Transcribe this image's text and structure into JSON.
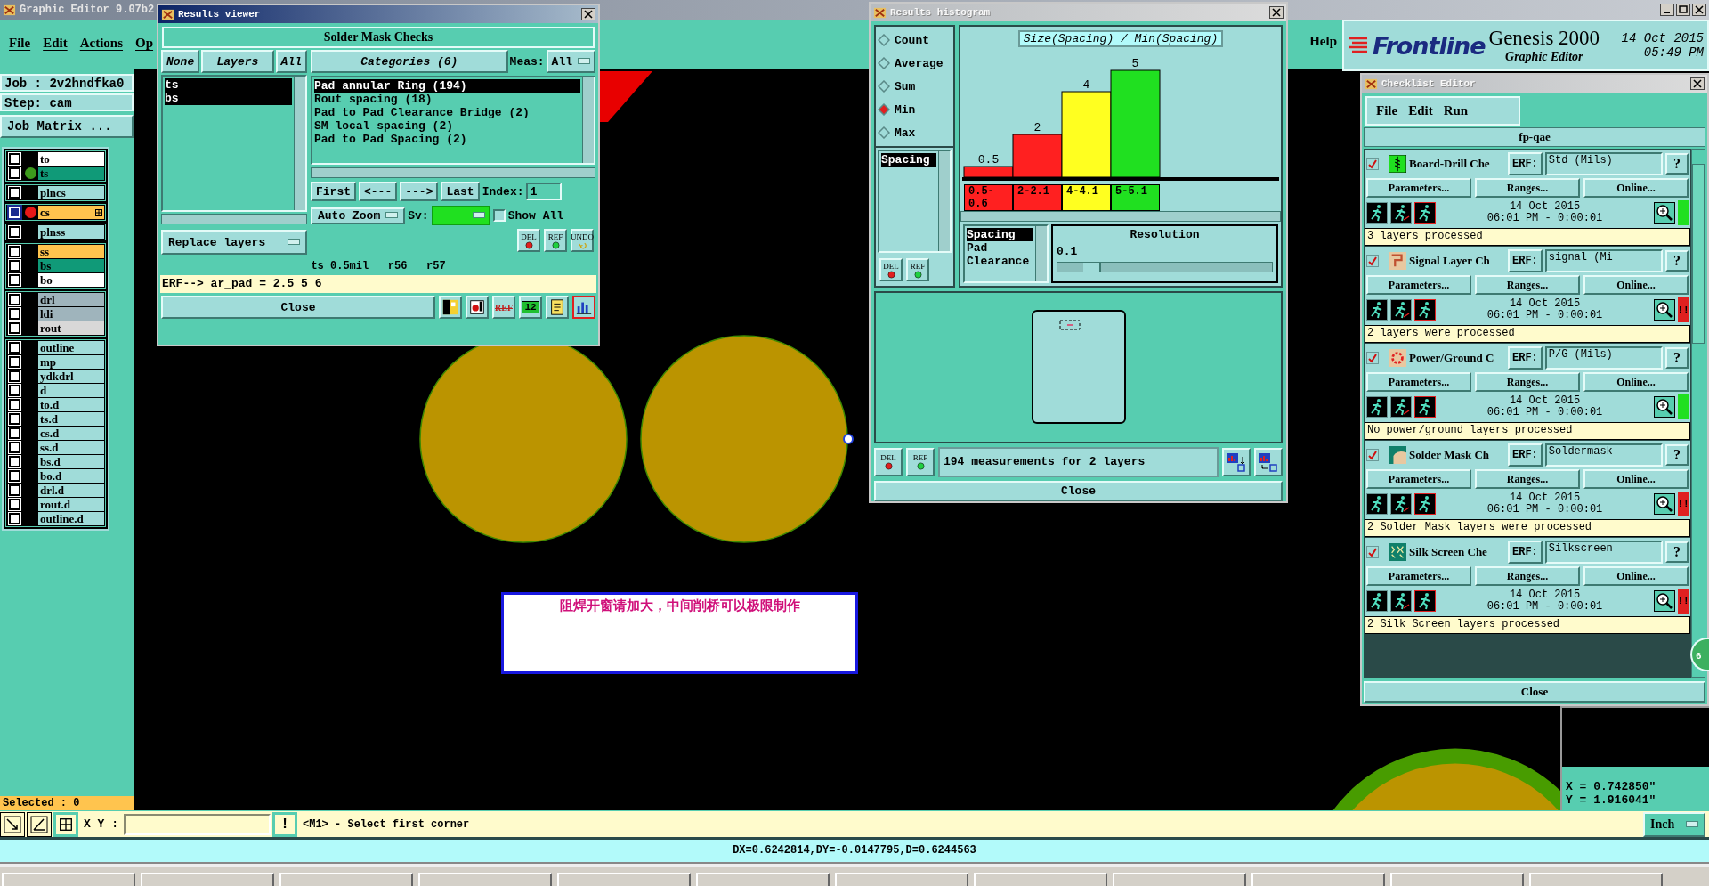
{
  "main_window": {
    "title": "Graphic Editor 9.07b2",
    "menu": [
      "File",
      "Edit",
      "Actions",
      "Op"
    ],
    "help": "Help"
  },
  "branding": {
    "logo": "Frontline",
    "product": "Genesis 2000",
    "subtitle": "Graphic Editor",
    "date": "14 Oct 2015",
    "time": "05:49 PM"
  },
  "job_panel": {
    "job": "Job : 2v2hndfka0",
    "step": "Step: cam",
    "job_matrix": "Job Matrix ...",
    "selected_count": "Selected : 0",
    "layer_groups": [
      [
        {
          "name": "to",
          "color": "#ffffff",
          "selected": false
        },
        {
          "name": "ts",
          "color": "#109a78",
          "selected": false,
          "dot": {
            "color": "#3c9a1c"
          }
        }
      ],
      [
        {
          "name": "plncs",
          "color": "#a0dcd9",
          "selected": false
        }
      ],
      [
        {
          "name": "cs",
          "color": "#ffc44e",
          "selected": true,
          "dot": {
            "color": "#e81818"
          }
        }
      ],
      [
        {
          "name": "plnss",
          "color": "#a0dcd9",
          "selected": false
        }
      ],
      [
        {
          "name": "ss",
          "color": "#ffc44e",
          "selected": false
        },
        {
          "name": "bs",
          "color": "#109a78",
          "selected": false
        },
        {
          "name": "bo",
          "color": "#ffffff",
          "selected": false
        }
      ],
      [
        {
          "name": "drl",
          "color": "#9fb4bc",
          "selected": false
        },
        {
          "name": "ldi",
          "color": "#9fb4bc",
          "selected": false
        },
        {
          "name": "rout",
          "color": "#d8d8d8",
          "selected": false
        }
      ],
      [
        {
          "name": "outline",
          "color": "#a0dcd9",
          "selected": false
        },
        {
          "name": "mp",
          "color": "#a0dcd9",
          "selected": false
        },
        {
          "name": "ydkdrl",
          "color": "#a0dcd9",
          "selected": false
        },
        {
          "name": "d",
          "color": "#a0dcd9",
          "selected": false
        },
        {
          "name": "to.d",
          "color": "#a0dcd9",
          "selected": false
        },
        {
          "name": "ts.d",
          "color": "#a0dcd9",
          "selected": false
        },
        {
          "name": "cs.d",
          "color": "#a0dcd9",
          "selected": false
        },
        {
          "name": "ss.d",
          "color": "#a0dcd9",
          "selected": false
        },
        {
          "name": "bs.d",
          "color": "#a0dcd9",
          "selected": false
        },
        {
          "name": "bo.d",
          "color": "#a0dcd9",
          "selected": false
        },
        {
          "name": "drl.d",
          "color": "#a0dcd9",
          "selected": false
        },
        {
          "name": "rout.d",
          "color": "#a0dcd9",
          "selected": false
        },
        {
          "name": "outline.d",
          "color": "#a0dcd9",
          "selected": false
        }
      ]
    ]
  },
  "results_viewer": {
    "title": "Results viewer",
    "heading": "Solder Mask Checks",
    "layer_buttons": [
      "None",
      "Layers",
      "All"
    ],
    "layers": [
      {
        "name": "ts",
        "selected": true
      },
      {
        "name": "bs",
        "selected": true
      }
    ],
    "replace": "Replace layers",
    "categories_button": "Categories (6)",
    "meas_label": "Meas:",
    "meas_value": "All",
    "categories": [
      {
        "label": "Pad annular Ring (194)",
        "selected": true
      },
      {
        "label": "Rout spacing (18)",
        "selected": false
      },
      {
        "label": "Pad to Pad Clearance Bridge (2)",
        "selected": false
      },
      {
        "label": "SM local spacing (2)",
        "selected": false
      },
      {
        "label": "Pad to Pad Spacing (2)",
        "selected": false
      }
    ],
    "nav": [
      "First",
      "<---",
      "--->",
      "Last"
    ],
    "index_label": "Index:",
    "index_value": "1",
    "zoom_mode": "Auto Zoom",
    "sv_label": "Sv:",
    "show_all": {
      "label": "Show All",
      "checked": false
    },
    "tools": [
      "DEL",
      "REF",
      "UNDO"
    ],
    "status": "ts 0.5mil   r56   r57",
    "erf": "ERF--> ar_pad = 2.5 5 6",
    "close": "Close",
    "footer_icons": [
      {
        "kind": "drill",
        "selected": false
      },
      {
        "kind": "pad",
        "selected": false
      },
      {
        "kind": "ref",
        "label": "REF",
        "selected": false
      },
      {
        "kind": "numbers",
        "label": "12",
        "selected": false
      },
      {
        "kind": "report",
        "selected": false
      },
      {
        "kind": "histogram",
        "selected": true
      }
    ]
  },
  "histogram": {
    "title": "Results histogram",
    "modes": [
      {
        "label": "Count",
        "selected": false
      },
      {
        "label": "Average",
        "selected": false
      },
      {
        "label": "Sum",
        "selected": false
      },
      {
        "label": "Min",
        "selected": true
      },
      {
        "label": "Max",
        "selected": false
      }
    ],
    "measures": [
      {
        "label": "Spacing",
        "selected": true
      }
    ],
    "tools": [
      "DEL",
      "REF"
    ],
    "chart_data": {
      "type": "bar",
      "title": "Size(Spacing) / Min(Spacing)",
      "categories": [
        "0.5-0.6",
        "2-2.1",
        "4-4.1",
        "5-5.1"
      ],
      "stacked": true,
      "data_labels": true,
      "series": [
        {
          "color": "#ff2020",
          "values": [
            0.5,
            2,
            null,
            null
          ]
        },
        {
          "color": "#ffff20",
          "values": [
            null,
            null,
            4,
            null
          ]
        },
        {
          "color": "#20e020",
          "values": [
            null,
            null,
            null,
            5
          ]
        }
      ]
    },
    "fields": [
      {
        "label": "Spacing",
        "selected": true
      },
      {
        "label": "Pad",
        "selected": false
      },
      {
        "label": "Clearance",
        "selected": false
      }
    ],
    "resolution": {
      "label": "Resolution",
      "value": "0.1",
      "level": 0.12
    },
    "bottom_tools": [
      "DEL",
      "REF"
    ],
    "message": "194 measurements for 2 layers",
    "close": "Close"
  },
  "checklist": {
    "title": "Checklist Editor",
    "menu": [
      "File",
      "Edit",
      "Run"
    ],
    "name": "fp-qae",
    "close": "Close",
    "actions": [
      {
        "checked": true,
        "kind": "drill",
        "name": "Board-Drill Che",
        "erf_label": "ERF:",
        "erf": "Std (Mils)",
        "help": "?",
        "buttons": [
          "Parameters...",
          "Ranges...",
          "Online..."
        ],
        "date": "14 Oct 2015",
        "time": "06:01 PM - 0:00:01",
        "indicator": {
          "color": "#20e020"
        },
        "message": "3 layers processed"
      },
      {
        "checked": true,
        "kind": "signal",
        "name": "Signal Layer Ch",
        "erf_label": "ERF:",
        "erf": "signal (Mi",
        "help": "?",
        "buttons": [
          "Parameters...",
          "Ranges...",
          "Online..."
        ],
        "date": "14 Oct 2015",
        "time": "06:01 PM - 0:00:01",
        "indicator": {
          "color": "#e02020"
        },
        "flag": "!!",
        "message": "2 layers were processed"
      },
      {
        "checked": true,
        "kind": "power",
        "name": "Power/Ground C",
        "erf_label": "ERF:",
        "erf": "P/G (Mils)",
        "help": "?",
        "buttons": [
          "Parameters...",
          "Ranges...",
          "Online..."
        ],
        "date": "14 Oct 2015",
        "time": "06:01 PM - 0:00:01",
        "indicator": {
          "color": "#20e020"
        },
        "message": "No power/ground layers processed"
      },
      {
        "checked": true,
        "kind": "mask",
        "name": "Solder Mask Ch",
        "erf_label": "ERF:",
        "erf": "Soldermask",
        "help": "?",
        "buttons": [
          "Parameters...",
          "Ranges...",
          "Online..."
        ],
        "date": "14 Oct 2015",
        "time": "06:01 PM - 0:00:01",
        "indicator": {
          "color": "#e02020"
        },
        "flag": "!!",
        "message": "2 Solder Mask layers were processed"
      },
      {
        "checked": true,
        "kind": "silk",
        "name": "Silk Screen Che",
        "erf_label": "ERF:",
        "erf": "Silkscreen",
        "help": "?",
        "buttons": [
          "Parameters...",
          "Ranges...",
          "Online..."
        ],
        "date": "14 Oct 2015",
        "time": "06:01 PM - 0:00:01",
        "indicator": {
          "color": "#e02020"
        },
        "flag": "!!",
        "message": "2 Silk Screen layers processed"
      }
    ]
  },
  "canvas": {
    "note": "阻焊开窗请加大，中间削桥可以极限制作",
    "coordinates": [
      "X = 0.742850\"",
      "Y = 1.916041\""
    ],
    "badge": "6"
  },
  "toolbar": {
    "xy_label": "X Y :",
    "alert": "!",
    "prompt": "<M1> - Select first corner",
    "units": "Inch"
  },
  "status_bar": "DX=0.6242814,DY=-0.0147795,D=0.6244563"
}
